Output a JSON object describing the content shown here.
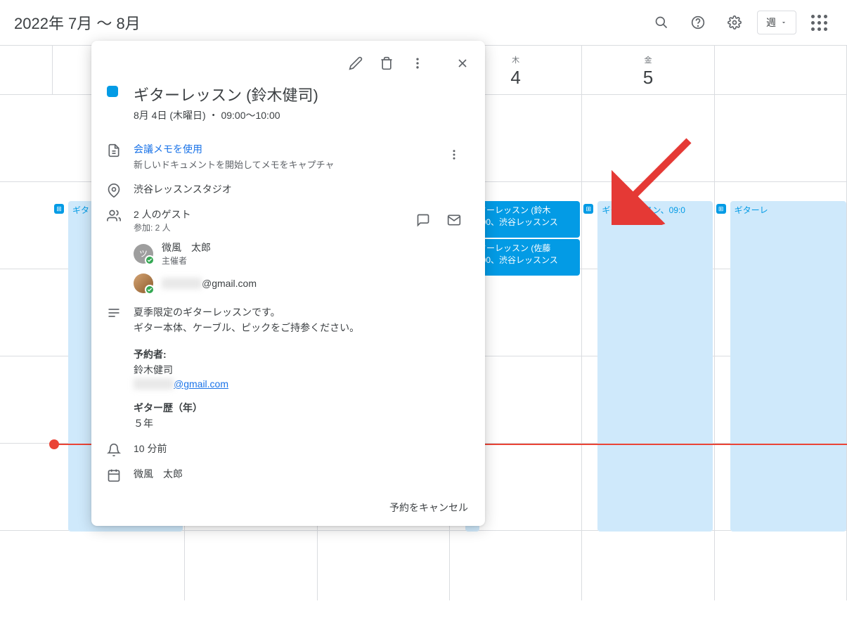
{
  "header": {
    "title": "2022年 7月 〜 8月",
    "view_label": "週"
  },
  "days": [
    {
      "label": "",
      "num": ""
    },
    {
      "label": "",
      "num": ""
    },
    {
      "label": "",
      "num": ""
    },
    {
      "label": "木",
      "num": "4"
    },
    {
      "label": "金",
      "num": "5"
    },
    {
      "label": "",
      "num": ""
    }
  ],
  "events": {
    "col0": {
      "line1": "ギタ"
    },
    "col3_a": {
      "line1": "ギターレッスン (鈴木",
      "line2": "09:00、渋谷レッスンス"
    },
    "col3_b": {
      "line1": "ギターレッスン (佐藤",
      "line2": "10:00、渋谷レッスンス"
    },
    "col4": {
      "line1": "ギターレッスン、09:0"
    },
    "col5": {
      "line1": "ギターレ"
    }
  },
  "popup": {
    "title": "ギターレッスン (鈴木健司)",
    "datetime": "8月 4日 (木曜日) ・ 09:00〜10:00",
    "notes_link": "会議メモを使用",
    "notes_sub": "新しいドキュメントを開始してメモをキャプチャ",
    "location": "渋谷レッスンスタジオ",
    "guest_count": "2 人のゲスト",
    "guest_sub": "参加: 2 人",
    "guest1_name": "微風　太郎",
    "guest1_role": "主催者",
    "guest2_email": "@gmail.com",
    "desc_line1": "夏季限定のギターレッスンです。",
    "desc_line2": "ギター本体、ケーブル、ピックをご持参ください。",
    "booker_label": "予約者:",
    "booker_name": "鈴木健司",
    "booker_email": "@gmail.com",
    "experience_label": "ギター歴（年）",
    "experience_val": "５年",
    "reminder": "10 分前",
    "calendar_owner": "微風　太郎",
    "cancel": "予約をキャンセル"
  }
}
